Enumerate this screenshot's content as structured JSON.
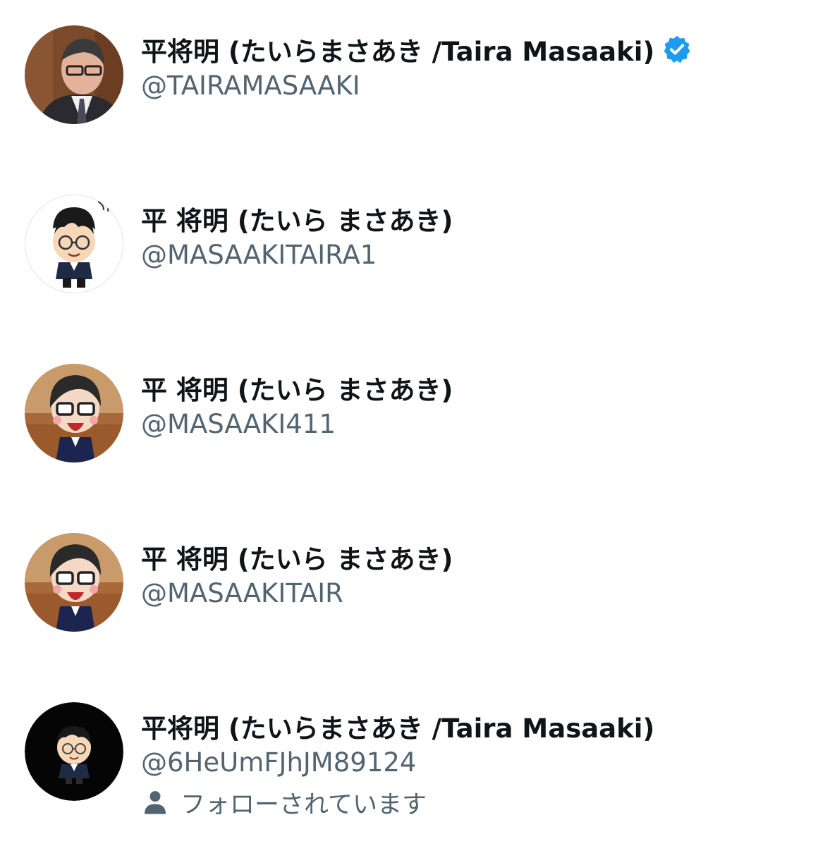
{
  "accounts": [
    {
      "display_name": "平将明 (たいらまさあき /Taira Masaaki)",
      "handle": "@TAIRAMASAAKI",
      "verified": true,
      "avatar": "photo-portrait"
    },
    {
      "display_name": "平 将明 (たいら まさあき)",
      "handle": "@MASAAKITAIRA1",
      "verified": false,
      "avatar": "cartoon-white"
    },
    {
      "display_name": "平 将明 (たいら まさあき)",
      "handle": "@MASAAKI411",
      "verified": false,
      "avatar": "figurine-photo"
    },
    {
      "display_name": "平 将明 (たいら まさあき)",
      "handle": "@MASAAKITAIR",
      "verified": false,
      "avatar": "figurine-photo"
    },
    {
      "display_name": "平将明 (たいらまさあき /Taira Masaaki)",
      "handle": "@6HeUmFJhJM89124",
      "verified": false,
      "avatar": "cartoon-black",
      "follows_you": "フォローされています"
    }
  ],
  "colors": {
    "name": "#0f1419",
    "handle": "#536471",
    "verified": "#1d9bf0"
  },
  "icons": {
    "verified": "verified-badge-icon",
    "follows": "person-icon"
  }
}
